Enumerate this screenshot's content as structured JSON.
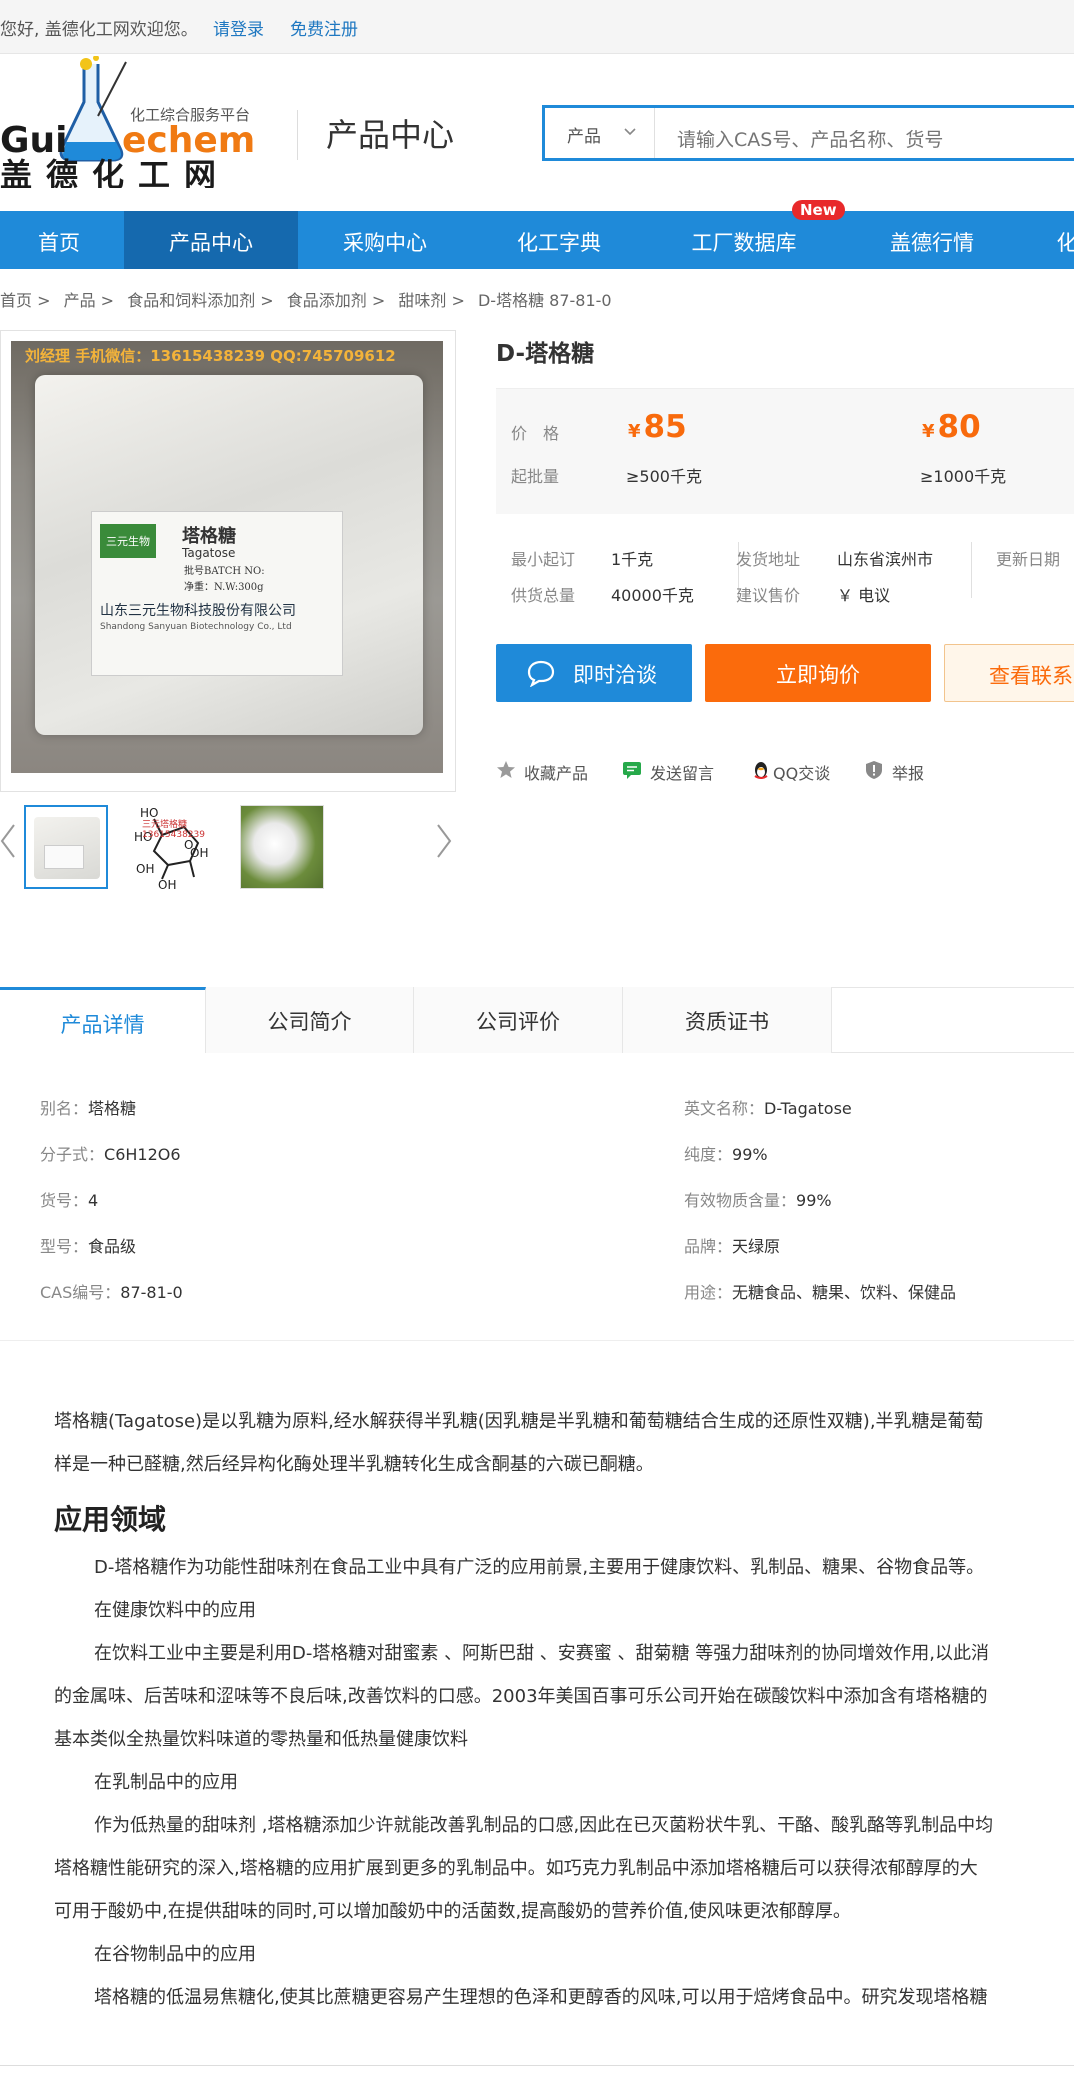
{
  "topbar": {
    "greeting": "您好, 盖德化工网欢迎您。",
    "login": "请登录",
    "register": "免费注册"
  },
  "header": {
    "logo_tagline": "化工综合服务平台",
    "logo_en": "Guidechem",
    "logo_cn": "盖德化工网",
    "section_title": "产品中心",
    "search": {
      "category": "产品",
      "placeholder": "请输入CAS号、产品名称、货号"
    }
  },
  "nav": {
    "items": [
      "首页",
      "产品中心",
      "采购中心",
      "化工字典",
      "工厂数据库",
      "盖德行情",
      "化"
    ],
    "active_index": 1,
    "new_badge": "New"
  },
  "breadcrumb": [
    "首页 >",
    "产品 >",
    "食品和饲料添加剂 >",
    "食品添加剂 >",
    "甜味剂 >",
    "D-塔格糖 87-81-0"
  ],
  "gallery": {
    "watermark": "刘经理 手机微信：13615438239 QQ:745709612",
    "label_brand": "三元生物",
    "label_name": "塔格糖",
    "label_en": "Tagatose",
    "label_batch": "批号BATCH NO:",
    "label_weight": "净重：N.W:300g",
    "label_company": "山东三元生物科技股份有限公司",
    "label_company_en": "Shandong Sanyuan Biotechnology Co., Ltd",
    "thumb_count": 3
  },
  "product": {
    "title": "D-塔格糖",
    "price_label": "价　格",
    "min_label": "起批量",
    "prices": [
      {
        "currency": "¥",
        "value": "85",
        "qty": "≥500千克"
      },
      {
        "currency": "¥",
        "value": "80",
        "qty": "≥1000千克"
      }
    ],
    "specs": {
      "min_order_label": "最小起订",
      "min_order": "1千克",
      "supply_label": "供货总量",
      "supply": "40000千克",
      "ship_label": "发货地址",
      "ship": "山东省滨州市",
      "suggest_label": "建议售价",
      "suggest": "￥ 电议",
      "update_label": "更新日期"
    },
    "buttons": {
      "chat": "即时洽谈",
      "inquire": "立即询价",
      "contact": "查看联系"
    },
    "actions": [
      "收藏产品",
      "发送留言",
      "QQ交谈",
      "举报"
    ]
  },
  "tabs": [
    "产品详情",
    "公司简介",
    "公司评价",
    "资质证书"
  ],
  "attributes": {
    "left": [
      {
        "k": "别名：",
        "v": "塔格糖"
      },
      {
        "k": "分子式：",
        "v": "C6H12O6"
      },
      {
        "k": "货号：",
        "v": "4"
      },
      {
        "k": "型号：",
        "v": "食品级"
      },
      {
        "k": "CAS编号：",
        "v": "87-81-0"
      }
    ],
    "right": [
      {
        "k": "英文名称：",
        "v": "D-Tagatose"
      },
      {
        "k": "纯度：",
        "v": "99%"
      },
      {
        "k": "有效物质含量：",
        "v": "99%"
      },
      {
        "k": "品牌：",
        "v": "天绿原"
      },
      {
        "k": "用途：",
        "v": "无糖食品、糖果、饮料、保健品"
      }
    ]
  },
  "description": {
    "intro_1": "塔格糖(Tagatose)是以乳糖为原料,经水解获得半乳糖(因乳糖是半乳糖和葡萄糖结合生成的还原性双糖),半乳糖是葡萄",
    "intro_2": "样是一种已醛糖,然后经异构化酶处理半乳糖转化生成含酮基的六碳已酮糖。",
    "heading": "应用领域",
    "p1": "D-塔格糖作为功能性甜味剂在食品工业中具有广泛的应用前景,主要用于健康饮料、乳制品、糖果、谷物食品等。",
    "sub1": "在健康饮料中的应用",
    "p2_1": "在饮料工业中主要是利用D-塔格糖对甜蜜素 、阿斯巴甜 、安赛蜜 、甜菊糖 等强力甜味剂的协同增效作用,以此消",
    "p2_2": "的金属味、后苦味和涩味等不良后味,改善饮料的口感。2003年美国百事可乐公司开始在碳酸饮料中添加含有塔格糖的",
    "p2_3": "基本类似全热量饮料味道的零热量和低热量健康饮料",
    "sub2": "在乳制品中的应用",
    "p3_1": "作为低热量的甜味剂 ,塔格糖添加少许就能改善乳制品的口感,因此在已灭菌粉状牛乳、干酪、酸乳酪等乳制品中均",
    "p3_2": "塔格糖性能研究的深入,塔格糖的应用扩展到更多的乳制品中。如巧克力乳制品中添加塔格糖后可以获得浓郁醇厚的大",
    "p3_3": "可用于酸奶中,在提供甜味的同时,可以增加酸奶中的活菌数,提高酸奶的营养价值,使风味更浓郁醇厚。",
    "sub3": "在谷物制品中的应用",
    "p4_1": "塔格糖的低温易焦糖化,使其比蔗糖更容易产生理想的色泽和更醇香的风味,可以用于焙烤食品中。研究发现塔格糖"
  },
  "colors": {
    "brand_blue": "#1f8ad9",
    "nav_active": "#1569ae",
    "price_orange": "#f86a0c",
    "button_orange": "#fb6b0c"
  }
}
